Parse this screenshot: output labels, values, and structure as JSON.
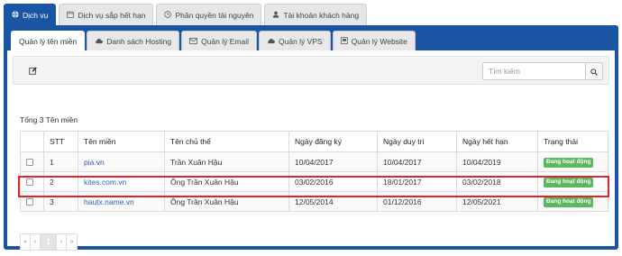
{
  "top_tabs": [
    {
      "label": "Dịch vụ",
      "icon": "globe-icon"
    },
    {
      "label": "Dịch vụ sắp hết hạn",
      "icon": "calendar-icon"
    },
    {
      "label": "Phân quyền tài nguyên",
      "icon": "clock-icon"
    },
    {
      "label": "Tài khoản khách hàng",
      "icon": "user-icon"
    }
  ],
  "sub_tabs": [
    {
      "label": "Quản lý tên miền",
      "icon": ""
    },
    {
      "label": "Danh sách Hosting",
      "icon": "cloud-icon"
    },
    {
      "label": "Quản lý Email",
      "icon": "envelope-icon"
    },
    {
      "label": "Quản lý VPS",
      "icon": "cloud-icon"
    },
    {
      "label": "Quản lý Website",
      "icon": "window-icon"
    }
  ],
  "toolbar": {
    "edit_icon": "pencil-icon"
  },
  "search": {
    "placeholder": "Tìm kiếm",
    "icon": "search-icon"
  },
  "summary": "Tổng 3 Tên miền",
  "table": {
    "headers": [
      "",
      "STT",
      "Tên miền",
      "Tên chủ thể",
      "Ngày đăng ký",
      "Ngày duy trì",
      "Ngày hết hạn",
      "Trạng thái"
    ],
    "rows": [
      {
        "stt": "1",
        "domain": "pia.vn",
        "owner": "Trần Xuân Hậu",
        "registered": "10/04/2017",
        "maintained": "10/04/2017",
        "expires": "10/04/2019",
        "status": "Đang hoạt động",
        "highlighted": true
      },
      {
        "stt": "2",
        "domain": "kites.com.vn",
        "owner": "Ông Trần Xuân Hậu",
        "registered": "03/02/2016",
        "maintained": "18/01/2017",
        "expires": "03/02/2018",
        "status": "Đang hoạt động",
        "highlighted": false
      },
      {
        "stt": "3",
        "domain": "hautx.name.vn",
        "owner": "Ông Trần Xuân Hậu",
        "registered": "12/05/2014",
        "maintained": "01/12/2016",
        "expires": "12/05/2021",
        "status": "Đang hoạt động",
        "highlighted": false
      }
    ]
  },
  "pagination": {
    "first": "«",
    "prev": "‹",
    "current": "1",
    "next": "›",
    "last": "»"
  },
  "colors": {
    "primary": "#1a55a3",
    "status_active": "#5cb85c",
    "highlight": "#e0242b",
    "link": "#2a64b5"
  }
}
